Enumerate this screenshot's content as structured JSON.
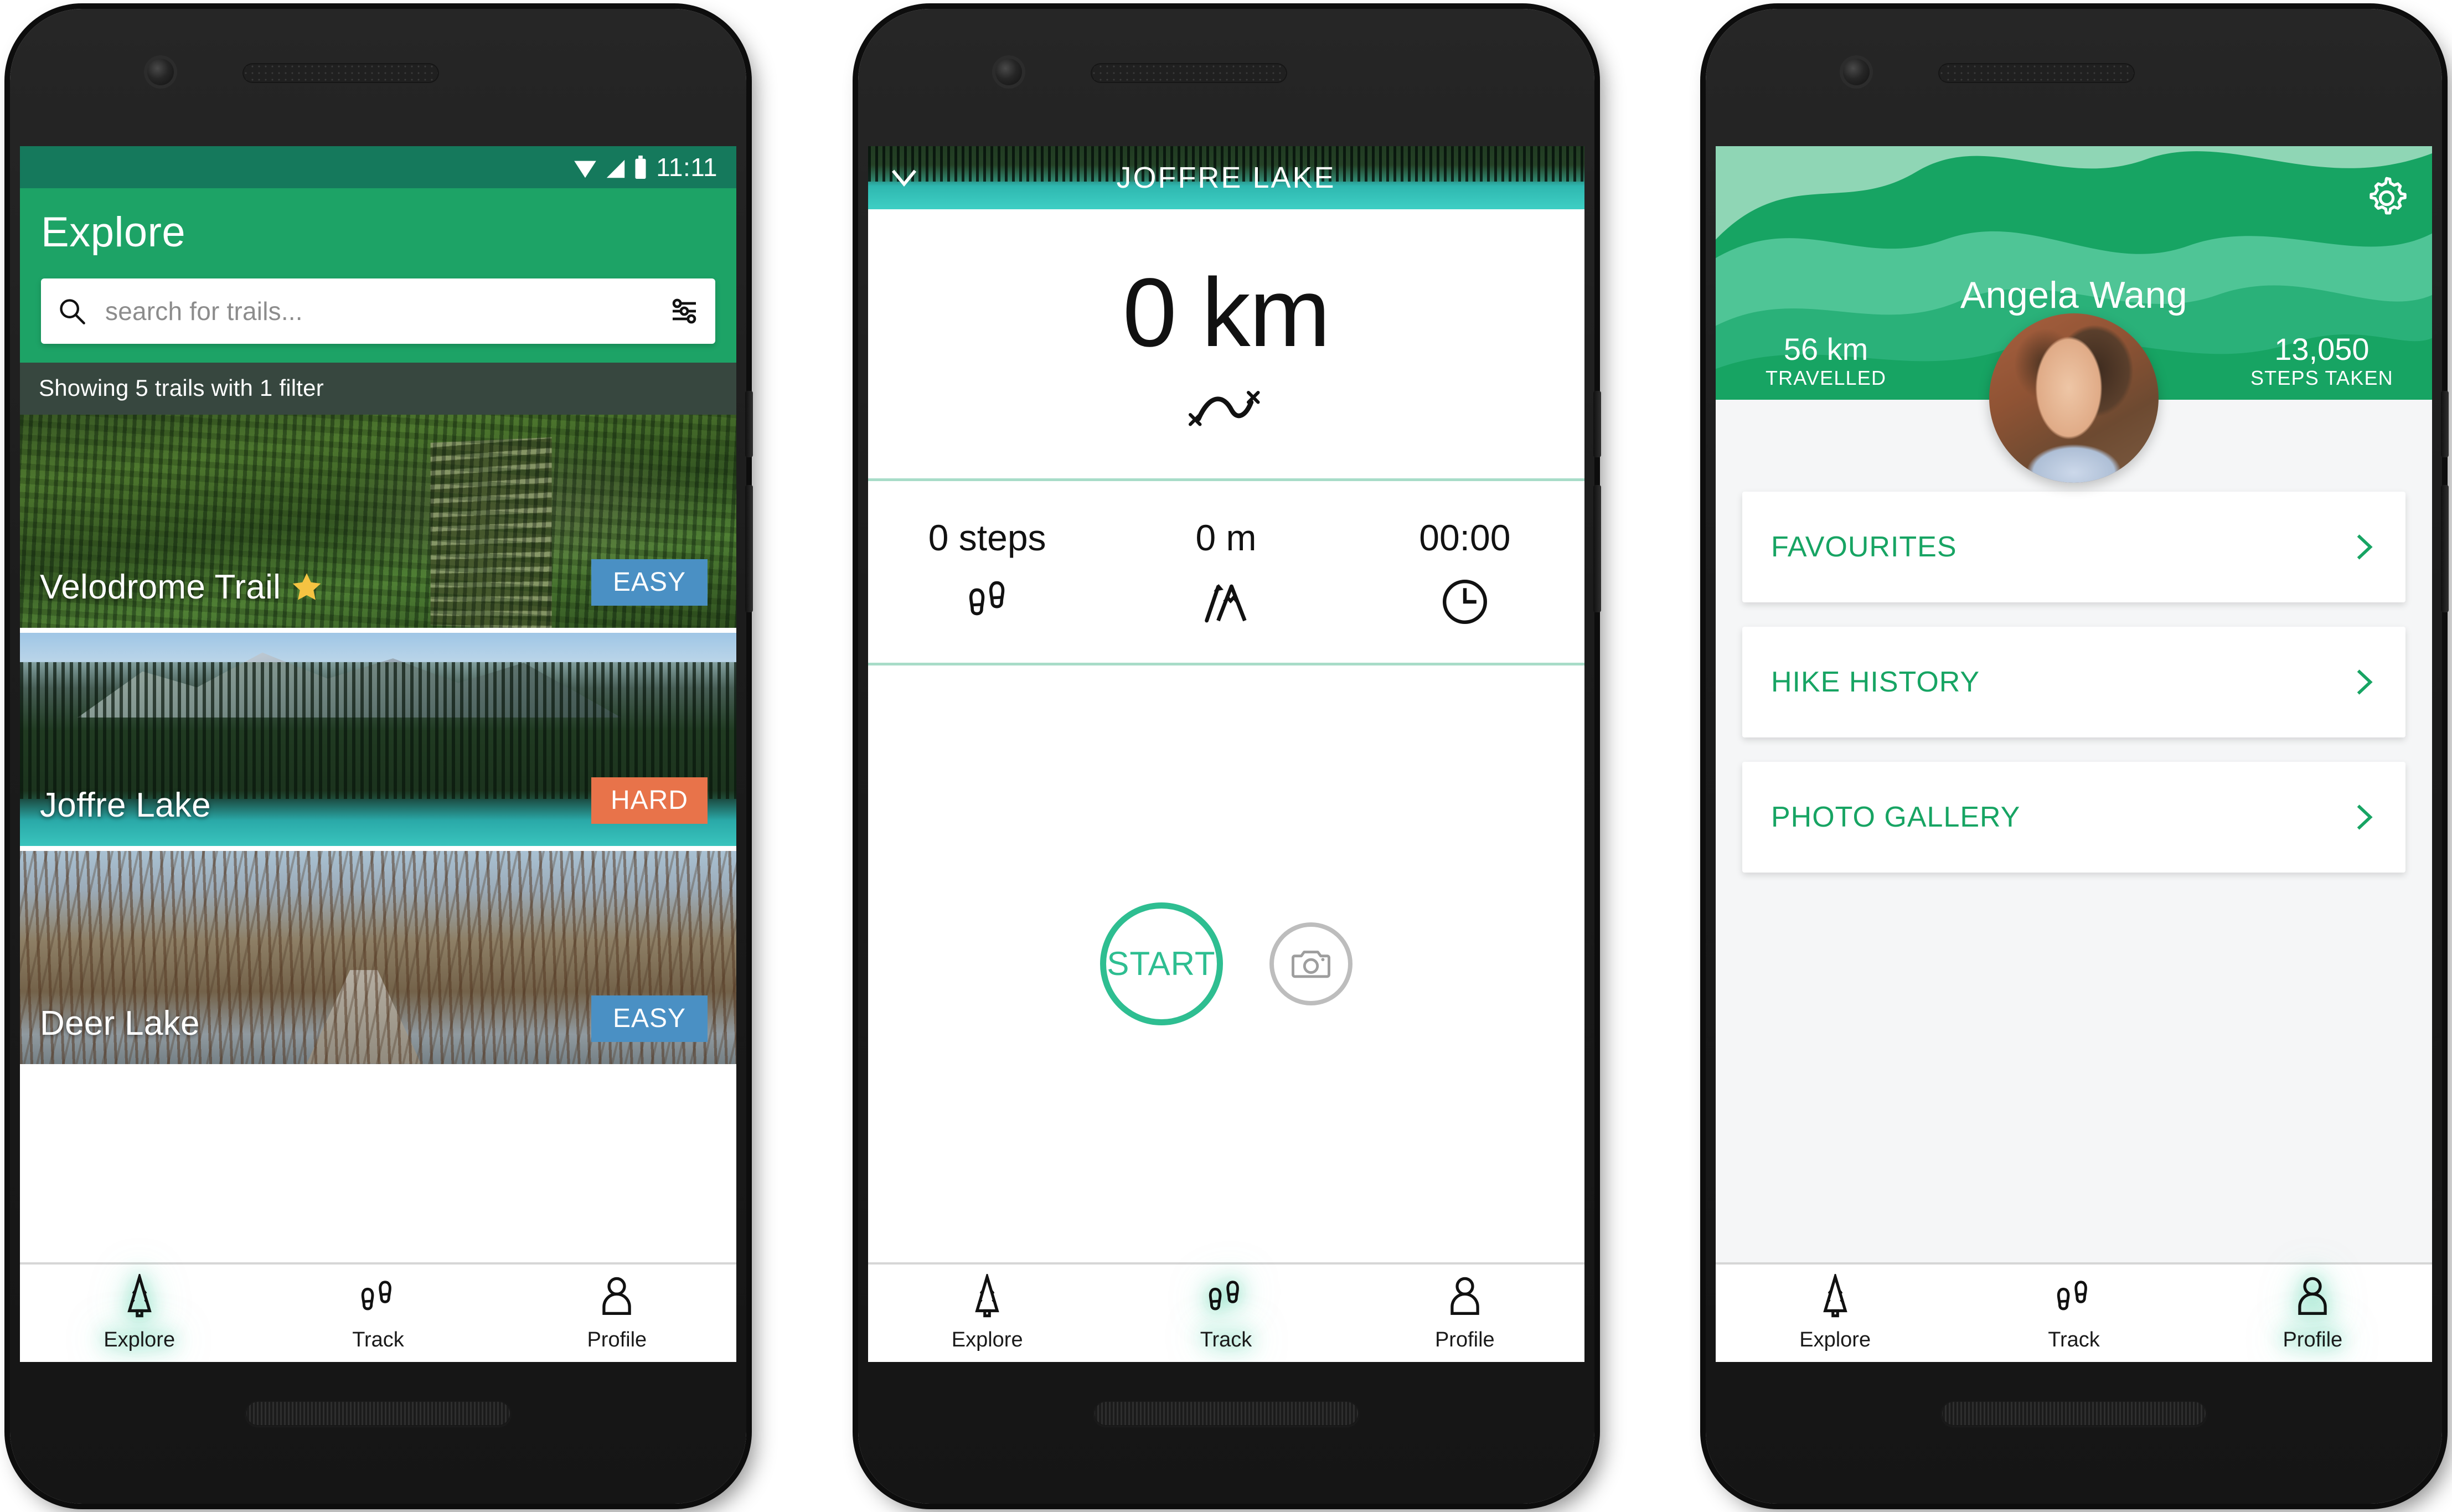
{
  "common": {
    "status_bar": {
      "time": "11:11",
      "wifi_icon": "wifi-icon",
      "signal_icon": "signal-icon",
      "battery_icon": "battery-icon"
    },
    "nav": {
      "items": [
        {
          "label": "Explore",
          "icon": "tree-icon"
        },
        {
          "label": "Track",
          "icon": "footsteps-icon"
        },
        {
          "label": "Profile",
          "icon": "person-icon"
        }
      ]
    },
    "colors": {
      "brand_green": "#1DA366",
      "status_green": "#15795C",
      "accent_teal": "#2EBE91",
      "link_green": "#17A463",
      "easy_blue": "#4A90C4",
      "hard_orange": "#E8734A",
      "star_yellow": "#F5C342",
      "filter_bar": "#37473F"
    }
  },
  "explore": {
    "title": "Explore",
    "search": {
      "placeholder": "search for trails...",
      "value": "",
      "search_icon": "search-icon",
      "filter_icon": "filter-sliders-icon"
    },
    "filter_status": "Showing 5 trails with 1 filter",
    "active_nav": "Explore",
    "trails": [
      {
        "name": "Velodrome Trail",
        "difficulty": "EASY",
        "difficulty_class": "badge-easy",
        "favourite": true,
        "image_class": "img-velodrome"
      },
      {
        "name": "Joffre Lake",
        "difficulty": "HARD",
        "difficulty_class": "badge-hard",
        "favourite": false,
        "image_class": "img-joffre"
      },
      {
        "name": "Deer Lake",
        "difficulty": "EASY",
        "difficulty_class": "badge-easy",
        "favourite": false,
        "image_class": "img-deer"
      }
    ]
  },
  "track": {
    "header": {
      "title": "JOFFRE LAKE",
      "back_icon": "chevron-down-icon"
    },
    "distance": {
      "value": "0 km",
      "route_icon": "route-squiggle-icon"
    },
    "stats": [
      {
        "value": "0 steps",
        "icon": "footsteps-icon"
      },
      {
        "value": "0 m",
        "icon": "elevation-mountain-icon"
      },
      {
        "value": "00:00",
        "icon": "clock-icon"
      }
    ],
    "start_button": "START",
    "camera_button_icon": "camera-icon",
    "active_nav": "Track"
  },
  "profile": {
    "name": "Angela Wang",
    "settings_icon": "gear-icon",
    "avatar_icon": "avatar",
    "stats": [
      {
        "value": "56 km",
        "label": "TRAVELLED"
      },
      {
        "value": "13,050",
        "label": "STEPS TAKEN"
      }
    ],
    "menu": [
      {
        "label": "FAVOURITES",
        "icon": "chevron-right-icon"
      },
      {
        "label": "HIKE HISTORY",
        "icon": "chevron-right-icon"
      },
      {
        "label": "PHOTO GALLERY",
        "icon": "chevron-right-icon"
      }
    ],
    "active_nav": "Profile"
  }
}
